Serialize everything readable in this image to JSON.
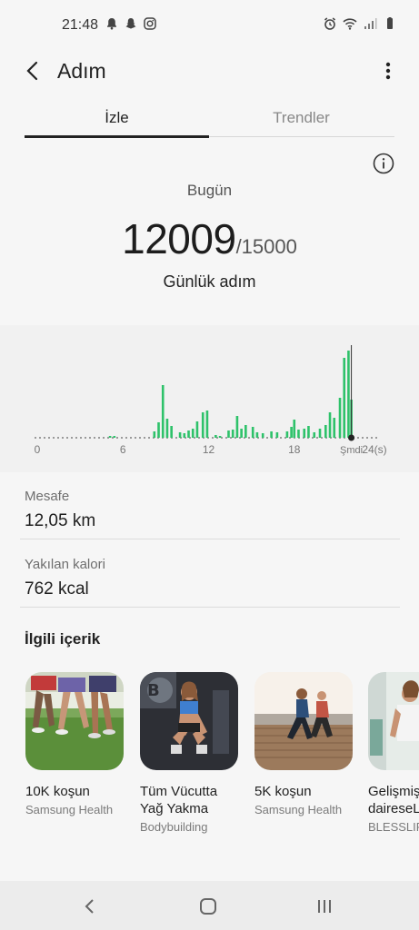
{
  "status_bar": {
    "time": "21:48"
  },
  "header": {
    "title": "Adım"
  },
  "tabs": [
    {
      "label": "İzle",
      "active": true
    },
    {
      "label": "Trendler",
      "active": false
    }
  ],
  "summary": {
    "day_label": "Bugün",
    "steps": "12009",
    "goal": "/15000",
    "caption": "Günlük adım"
  },
  "chart_data": {
    "type": "bar",
    "xlabel": "",
    "ylabel": "",
    "x_ticks": [
      "0",
      "6",
      "12",
      "18",
      "Şmdi",
      "24(s)"
    ],
    "xlim": [
      0,
      24
    ],
    "accent_color": "#2ec26a",
    "bars": [
      {
        "hour": 5.1,
        "value": 2
      },
      {
        "hour": 5.4,
        "value": 2
      },
      {
        "hour": 8.2,
        "value": 7
      },
      {
        "hour": 8.5,
        "value": 17
      },
      {
        "hour": 8.8,
        "value": 58
      },
      {
        "hour": 9.1,
        "value": 21
      },
      {
        "hour": 9.4,
        "value": 13
      },
      {
        "hour": 10.0,
        "value": 6
      },
      {
        "hour": 10.3,
        "value": 5
      },
      {
        "hour": 10.6,
        "value": 8
      },
      {
        "hour": 10.9,
        "value": 10
      },
      {
        "hour": 11.2,
        "value": 18
      },
      {
        "hour": 11.6,
        "value": 28
      },
      {
        "hour": 11.9,
        "value": 30
      },
      {
        "hour": 12.5,
        "value": 3
      },
      {
        "hour": 12.8,
        "value": 2
      },
      {
        "hour": 13.4,
        "value": 8
      },
      {
        "hour": 13.7,
        "value": 9
      },
      {
        "hour": 14.0,
        "value": 24
      },
      {
        "hour": 14.3,
        "value": 10
      },
      {
        "hour": 14.6,
        "value": 14
      },
      {
        "hour": 15.1,
        "value": 12
      },
      {
        "hour": 15.4,
        "value": 6
      },
      {
        "hour": 15.8,
        "value": 5
      },
      {
        "hour": 16.4,
        "value": 7
      },
      {
        "hour": 16.8,
        "value": 6
      },
      {
        "hour": 17.5,
        "value": 7
      },
      {
        "hour": 17.8,
        "value": 12
      },
      {
        "hour": 18.0,
        "value": 20
      },
      {
        "hour": 18.3,
        "value": 9
      },
      {
        "hour": 18.7,
        "value": 10
      },
      {
        "hour": 19.0,
        "value": 13
      },
      {
        "hour": 19.4,
        "value": 6
      },
      {
        "hour": 19.8,
        "value": 10
      },
      {
        "hour": 20.2,
        "value": 14
      },
      {
        "hour": 20.5,
        "value": 28
      },
      {
        "hour": 20.8,
        "value": 22
      },
      {
        "hour": 21.2,
        "value": 44
      },
      {
        "hour": 21.5,
        "value": 88
      },
      {
        "hour": 21.8,
        "value": 96
      },
      {
        "hour": 22.0,
        "value": 42
      }
    ]
  },
  "stats": [
    {
      "label": "Mesafe",
      "value": "12,05 km"
    },
    {
      "label": "Yakılan kalori",
      "value": "762 kcal"
    }
  ],
  "related": {
    "title": "İlgili içerik",
    "cards": [
      {
        "title_lines": [
          "10K koşun"
        ],
        "source": "Samsung Health",
        "image": "runners-legs"
      },
      {
        "title_lines": [
          "Tüm Vücutta",
          "Yağ Yakma"
        ],
        "source": "Bodybuilding",
        "image": "woman-squat"
      },
      {
        "title_lines": [
          "5K koşun"
        ],
        "source": "Samsung Health",
        "image": "runners-boardwalk"
      },
      {
        "title_lines": [
          "Gelişmiş",
          "daireseL"
        ],
        "source": "BLESSLIF",
        "image": "woman-training"
      }
    ]
  },
  "nav_bar": {
    "icons": [
      "back-icon",
      "home-icon",
      "recent-apps-icon"
    ]
  }
}
